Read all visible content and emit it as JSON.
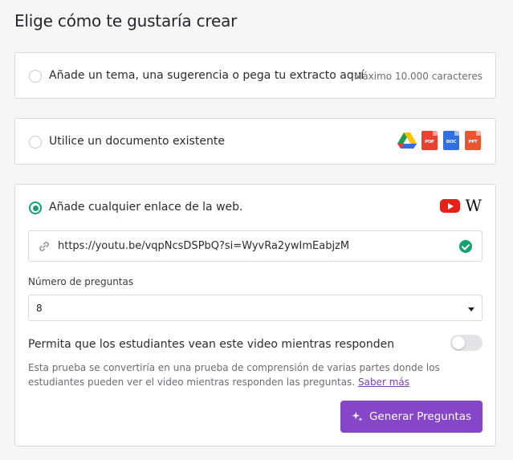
{
  "page": {
    "title": "Elige cómo te gustaría crear"
  },
  "option_text": {
    "label": "Añade un tema, una sugerencia o pega tu extracto aquí",
    "hint": "Máximo 10.000 caracteres"
  },
  "option_document": {
    "label": "Utilice un documento existente",
    "icons": [
      {
        "name": "google-drive-icon"
      },
      {
        "name": "pdf-icon",
        "tag": "PDF",
        "color": "#e8412f"
      },
      {
        "name": "doc-icon",
        "tag": "DOC",
        "color": "#2f6fe0"
      },
      {
        "name": "ppt-icon",
        "tag": "PPT",
        "color": "#e8572f"
      }
    ]
  },
  "option_link": {
    "label": "Añade cualquier enlace de la web.",
    "wiki_glyph": "W",
    "url_value": "https://youtu.be/vqpNcsDSPbQ?si=WyvRa2ywImEabjzM",
    "question_count_label": "Número de preguntas",
    "question_count_value": "8",
    "toggle_label": "Permita que los estudiantes vean este video mientras responden",
    "toggle_on": false,
    "description": "Esta prueba se convertiría en una prueba de comprensión de varias partes donde los estudiantes pueden ver el video mientras responden las preguntas.",
    "learn_more": "Saber más",
    "generate_label": "Generar Preguntas"
  },
  "colors": {
    "accent_green": "#12a16f",
    "button_purple": "#8646c8",
    "link_purple": "#7a3fb8"
  }
}
